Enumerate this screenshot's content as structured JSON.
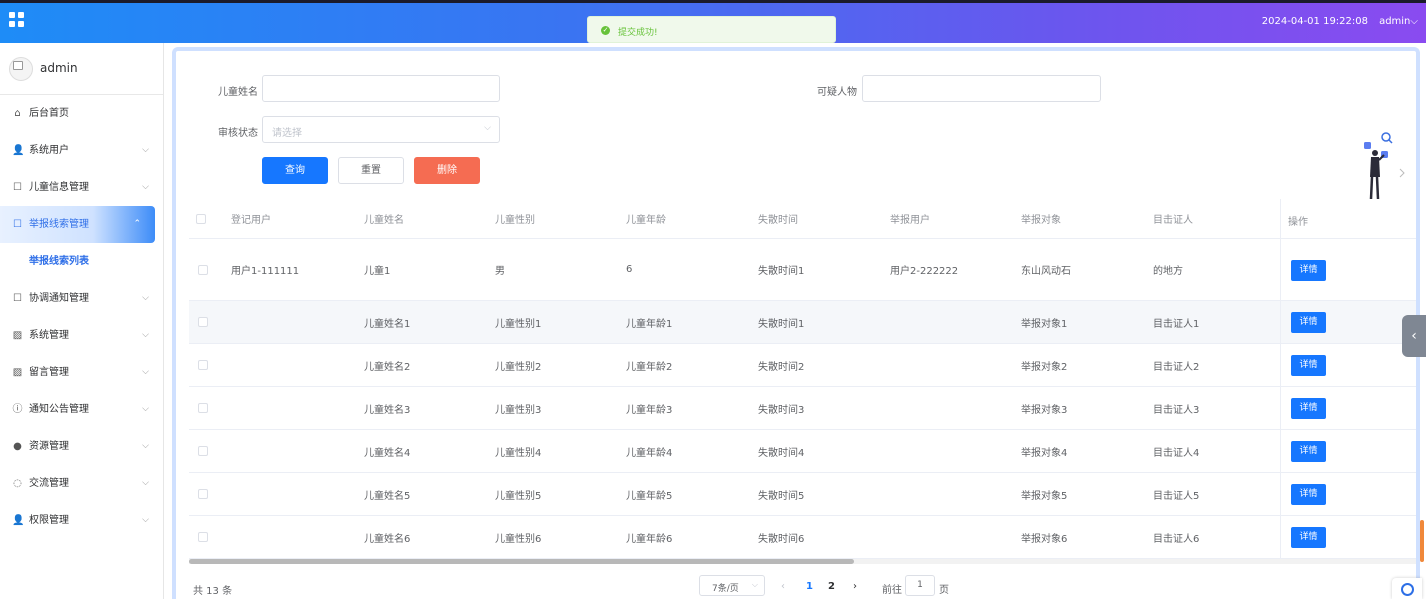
{
  "header": {
    "datetime": "2024-04-01 19:22:08",
    "user": "admin",
    "user_arrow": "⌵"
  },
  "toast": {
    "message": "提交成功!"
  },
  "sidebar": {
    "username": "admin",
    "items": [
      {
        "label": "后台首页",
        "icon": "home-icon",
        "glyph": "⌂",
        "arrow": ""
      },
      {
        "label": "系统用户",
        "icon": "user-icon",
        "glyph": "👤",
        "arrow": "⌵"
      },
      {
        "label": "儿童信息管理",
        "icon": "edit-icon",
        "glyph": "☐",
        "arrow": "⌵"
      },
      {
        "label": "举报线索管理",
        "icon": "edit-icon",
        "glyph": "☐",
        "arrow": "⌃",
        "active": true
      },
      {
        "label": "协调通知管理",
        "icon": "edit-icon",
        "glyph": "☐",
        "arrow": "⌵"
      },
      {
        "label": "系统管理",
        "icon": "image-icon",
        "glyph": "▨",
        "arrow": "⌵"
      },
      {
        "label": "留言管理",
        "icon": "image-icon",
        "glyph": "▨",
        "arrow": "⌵"
      },
      {
        "label": "通知公告管理",
        "icon": "info-icon",
        "glyph": "ⓘ",
        "arrow": "⌵"
      },
      {
        "label": "资源管理",
        "icon": "location-icon",
        "glyph": "●",
        "arrow": "⌵"
      },
      {
        "label": "交流管理",
        "icon": "chat-icon",
        "glyph": "◌",
        "arrow": "⌵"
      },
      {
        "label": "权限管理",
        "icon": "user-icon",
        "glyph": "👤",
        "arrow": "⌵"
      }
    ],
    "submenu": {
      "label": "举报线索列表"
    }
  },
  "search": {
    "child_name_label": "儿童姓名",
    "suspect_label": "可疑人物",
    "audit_label": "审核状态",
    "audit_placeholder": "请选择",
    "query_btn": "查询",
    "reset_btn": "重置",
    "delete_btn": "删除"
  },
  "table": {
    "headers": [
      "登记用户",
      "儿童姓名",
      "儿童性别",
      "儿童年龄",
      "失散时间",
      "举报用户",
      "举报对象",
      "目击证人",
      "操作"
    ],
    "rows": [
      [
        "用户1-111111",
        "儿童1",
        "男",
        "6",
        "失散时间1",
        "用户2-222222",
        "东山风动石",
        "的地方"
      ],
      [
        "",
        "儿童姓名1",
        "儿童性别1",
        "儿童年龄1",
        "失散时间1",
        "",
        "举报对象1",
        "目击证人1"
      ],
      [
        "",
        "儿童姓名2",
        "儿童性别2",
        "儿童年龄2",
        "失散时间2",
        "",
        "举报对象2",
        "目击证人2"
      ],
      [
        "",
        "儿童姓名3",
        "儿童性别3",
        "儿童年龄3",
        "失散时间3",
        "",
        "举报对象3",
        "目击证人3"
      ],
      [
        "",
        "儿童姓名4",
        "儿童性别4",
        "儿童年龄4",
        "失散时间4",
        "",
        "举报对象4",
        "目击证人4"
      ],
      [
        "",
        "儿童姓名5",
        "儿童性别5",
        "儿童年龄5",
        "失散时间5",
        "",
        "举报对象5",
        "目击证人5"
      ],
      [
        "",
        "儿童姓名6",
        "儿童性别6",
        "儿童年龄6",
        "失散时间6",
        "",
        "举报对象6",
        "目击证人6"
      ]
    ],
    "detail_btn": "详情"
  },
  "pagination": {
    "total": "共 13 条",
    "page_size": "7条/页",
    "pages": [
      "1",
      "2"
    ],
    "current": "1",
    "prev": "‹",
    "next": "›",
    "goto_prefix": "前往",
    "goto_value": "1",
    "goto_suffix": "页"
  },
  "colors": {
    "accent": "#1677ff",
    "danger": "#f56c52",
    "success": "#67c23a"
  }
}
